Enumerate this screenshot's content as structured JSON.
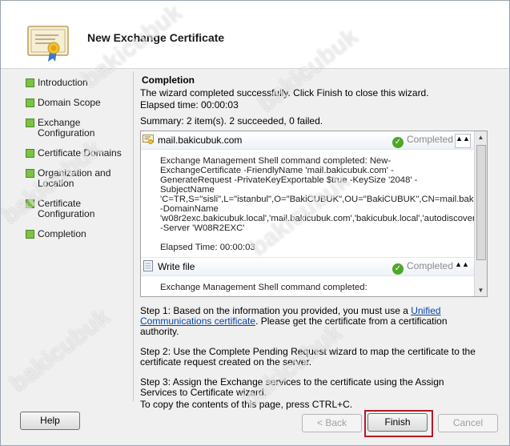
{
  "window": {
    "title": "New Exchange Certificate"
  },
  "sidebar": {
    "steps": [
      {
        "label": "Introduction"
      },
      {
        "label": "Domain Scope"
      },
      {
        "label": "Exchange Configuration"
      },
      {
        "label": "Certificate Domains"
      },
      {
        "label": "Organization and Location"
      },
      {
        "label": "Certificate Configuration"
      },
      {
        "label": "Completion"
      }
    ]
  },
  "main": {
    "page_title": "Completion",
    "success_text": "The wizard completed successfully. Click Finish to close this wizard.",
    "elapsed": "Elapsed time: 00:00:03",
    "summary": "Summary: 2 item(s). 2 succeeded, 0 failed."
  },
  "results": {
    "items": [
      {
        "name": "mail.bakicubuk.com",
        "status": "Completed",
        "body": "Exchange Management Shell command completed: New-ExchangeCertificate -FriendlyName 'mail.bakicubuk.com' -GenerateRequest -PrivateKeyExportable $true -KeySize '2048' -SubjectName 'C=TR,S=\"sisli\",L=\"istanbul\",O=\"BakiCUBUK\",OU=\"BakiCUBUK\",CN=mail.bakicubuk.com' -DomainName 'w08r2exc.bakicubuk.local','mail.bakicubuk.com','bakicubuk.local','autodiscover.bakicubuk.local','legacy.bakicubuk.local','autodiscover.bakicubuk.com','legacy.bakicubuk.com','bakicubuk.com','w08r2exc' -Server 'W08R2EXC'",
        "elapsed": "Elapsed Time: 00:00:03"
      },
      {
        "name": "Write file",
        "status": "Completed",
        "body": "Exchange Management Shell command completed:"
      }
    ]
  },
  "instructions": {
    "step1_prefix": "Step 1: Based on the information you provided, you must use a ",
    "step1_link": "Unified Communications certificate",
    "step1_suffix": ". Please get the certificate from a certification authority.",
    "step2": "Step 2: Use the Complete Pending Request wizard to map the certificate to the certificate request created on the server.",
    "step3": "Step 3: Assign the Exchange services to the certificate using the Assign Services to Certificate wizard."
  },
  "footer": {
    "copy_note": "To copy the contents of this page, press CTRL+C.",
    "help_label": "Help",
    "back_label": "< Back",
    "finish_label": "Finish",
    "cancel_label": "Cancel"
  },
  "watermark": {
    "text": "bakicubuk"
  },
  "colors": {
    "accent_bullet": "#7cc243",
    "highlight": "#b11c24",
    "link": "#0645ad"
  }
}
